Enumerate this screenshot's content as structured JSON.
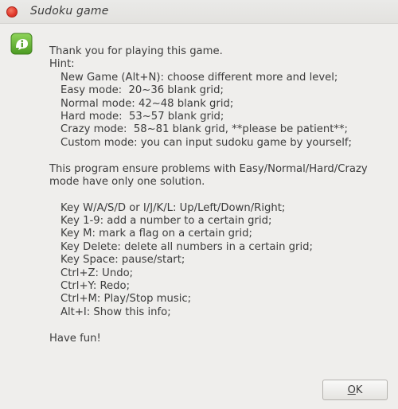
{
  "window": {
    "title": "Sudoku game"
  },
  "dialog": {
    "icon": "info-icon",
    "intro": "Thank you for playing this game.",
    "hint_label": "Hint:",
    "hints": [
      "New Game (Alt+N): choose different more and level;",
      "Easy mode:  20~36 blank grid;",
      "Normal mode: 42~48 blank grid;",
      "Hard mode:  53~57 blank grid;",
      "Crazy mode:  58~81 blank grid, **please be patient**;",
      "Custom mode: you can input sudoku game by yourself;"
    ],
    "solution_note_1": "This program ensure problems with Easy/Normal/Hard/Crazy",
    "solution_note_2": "mode have only one solution.",
    "keys": [
      "Key W/A/S/D or I/J/K/L: Up/Left/Down/Right;",
      "Key 1-9: add a number to a certain grid;",
      "Key M: mark a flag on a certain grid;",
      "Key Delete: delete all numbers in a certain grid;",
      "Key Space: pause/start;",
      "Ctrl+Z: Undo;",
      "Ctrl+Y: Redo;",
      "Ctrl+M: Play/Stop music;",
      "Alt+I: Show this info;"
    ],
    "outro": "Have fun!"
  },
  "buttons": {
    "ok_mnemonic": "O",
    "ok_rest": "K"
  },
  "colors": {
    "close_button": "#e0362a",
    "icon_green": "#5aa02c"
  }
}
